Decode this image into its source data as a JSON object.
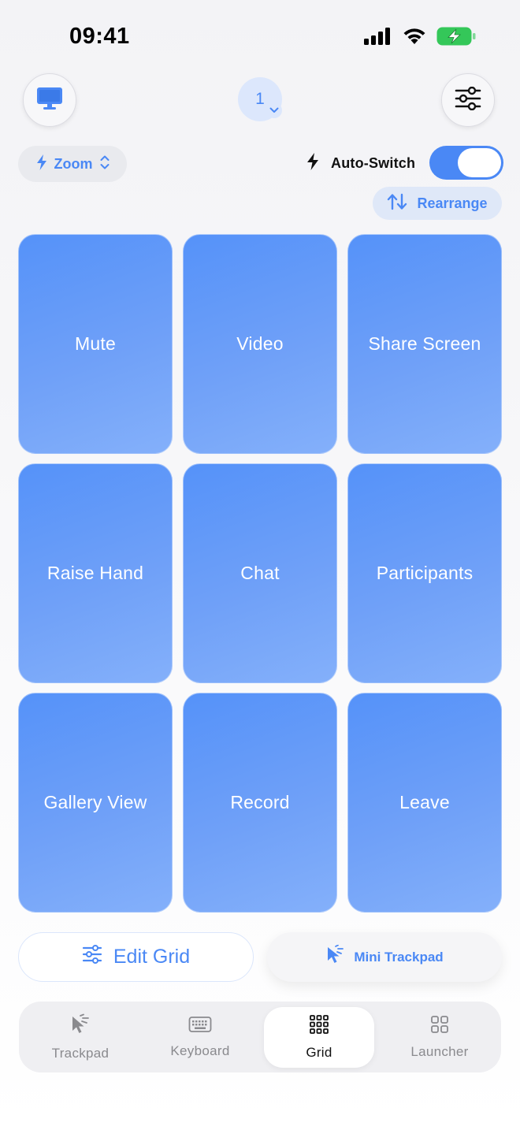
{
  "status_bar": {
    "time": "09:41",
    "icons": [
      "cellular-signal-icon",
      "wifi-icon",
      "battery-charging-icon"
    ]
  },
  "header": {
    "screen_number": "1",
    "left_icon": "monitor-icon",
    "right_icon": "sliders-icon"
  },
  "app_selector": {
    "label": "Zoom",
    "icon": "bolt-icon"
  },
  "auto_switch": {
    "label": "Auto-Switch",
    "enabled": true
  },
  "rearrange": {
    "label": "Rearrange"
  },
  "grid": {
    "tiles": [
      "Mute",
      "Video",
      "Share Screen",
      "Raise Hand",
      "Chat",
      "Participants",
      "Gallery View",
      "Record",
      "Leave"
    ]
  },
  "actions": {
    "edit_grid": "Edit Grid",
    "mini_trackpad": "Mini Trackpad"
  },
  "tab_bar": {
    "tabs": [
      {
        "label": "Trackpad",
        "icon": "cursor-icon",
        "active": false
      },
      {
        "label": "Keyboard",
        "icon": "keyboard-icon",
        "active": false
      },
      {
        "label": "Grid",
        "icon": "grid-icon",
        "active": true
      },
      {
        "label": "Launcher",
        "icon": "launcher-icon",
        "active": false
      }
    ]
  },
  "colors": {
    "accent": "#4a88f5",
    "tile": "#5f98f8",
    "background": "#f3f3f6"
  }
}
